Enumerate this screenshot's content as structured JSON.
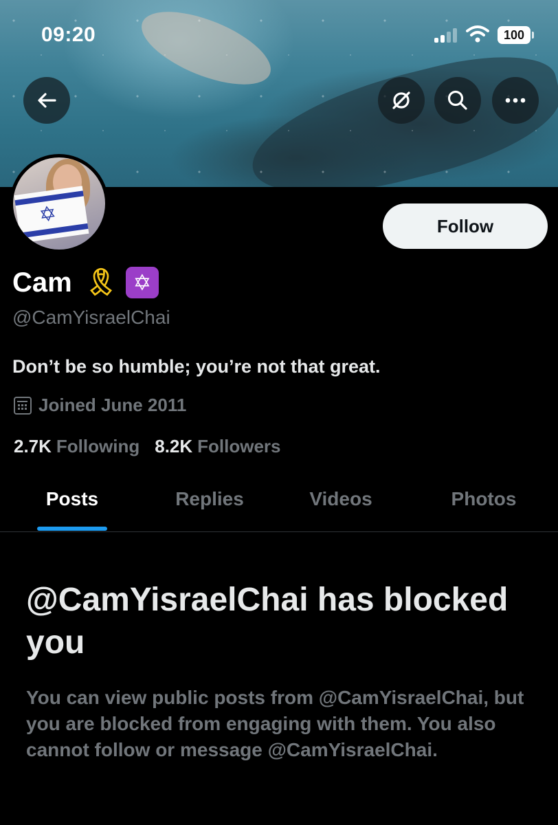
{
  "status_bar": {
    "time": "09:20",
    "battery": "100"
  },
  "profile": {
    "display_name": "Cam",
    "badges": [
      "ribbon",
      "star-of-david"
    ],
    "handle": "@CamYisraelChai",
    "bio": "Don’t be so humble; you’re not that great.",
    "joined": "Joined June 2011",
    "following_count": "2.7K",
    "following_label": "Following",
    "followers_count": "8.2K",
    "followers_label": "Followers"
  },
  "actions": {
    "follow_label": "Follow"
  },
  "icons": {
    "back": "arrow-left-icon",
    "grok": "slashed-circle-icon",
    "search": "search-icon",
    "more": "more-horizontal-icon",
    "joined": "calendar-icon"
  },
  "tabs": [
    {
      "label": "Posts",
      "active": true
    },
    {
      "label": "Replies",
      "active": false
    },
    {
      "label": "Videos",
      "active": false
    },
    {
      "label": "Photos",
      "active": false
    }
  ],
  "blocked": {
    "title": "@CamYisraelChai has blocked you",
    "body": "You can view public posts from @CamYisraelChai, but you are blocked from engaging with them. You also cannot follow or message @CamYisraelChai."
  },
  "colors": {
    "background": "#000000",
    "accent": "#1d9bf0",
    "primary_text": "#e7e9ea",
    "secondary_text": "#71767b",
    "follow_button_bg": "#eff3f4",
    "star_badge": "#9b3ec8",
    "ribbon": "#f5c518"
  }
}
